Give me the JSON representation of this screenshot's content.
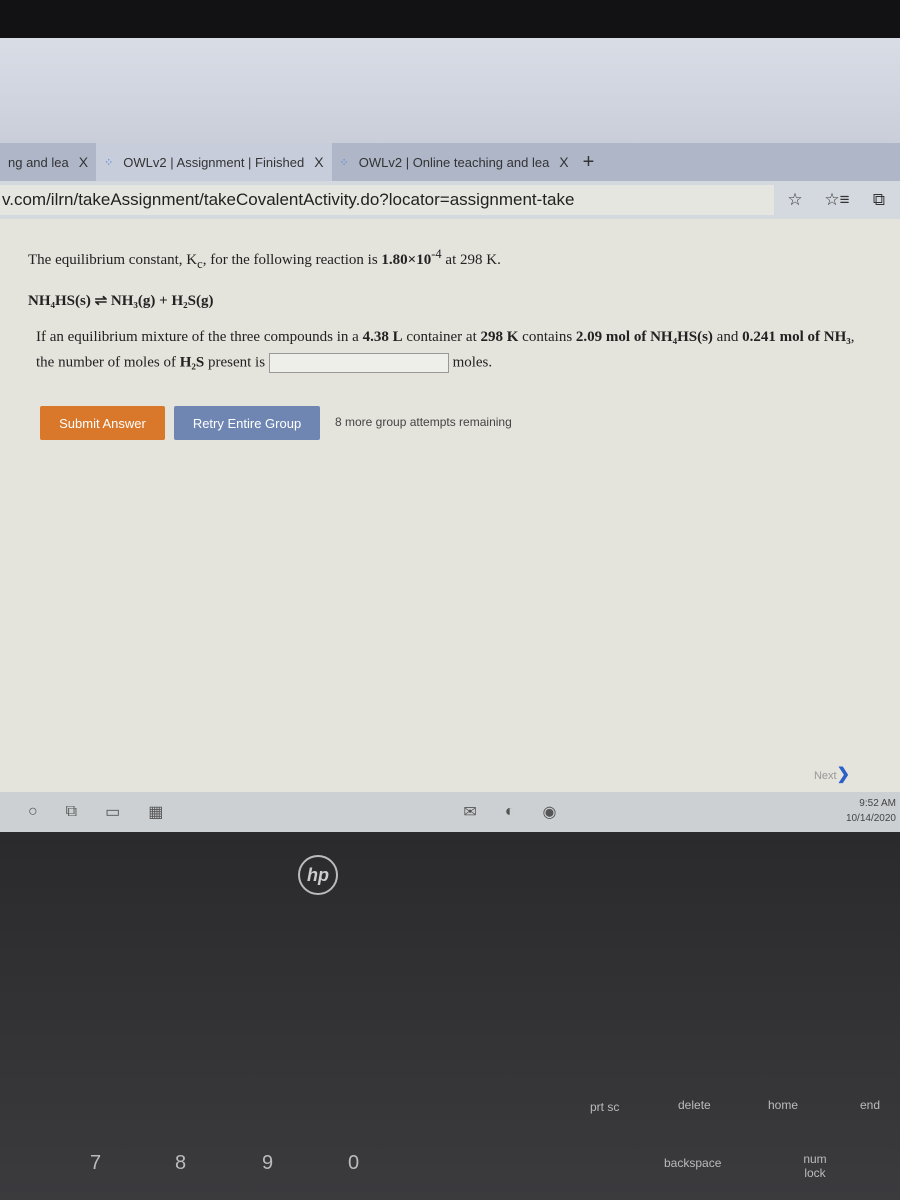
{
  "browser": {
    "tabs": [
      {
        "label": "ng and lea",
        "close": "X"
      },
      {
        "label": "OWLv2 | Assignment | Finished",
        "close": "X"
      },
      {
        "label": "OWLv2 | Online teaching and lea",
        "close": "X"
      }
    ],
    "new_tab": "+",
    "url": "v.com/ilrn/takeAssignment/takeCovalentActivity.do?locator=assignment-take",
    "icons": [
      "star-icon",
      "favorites-icon",
      "collections-icon"
    ]
  },
  "question": {
    "intro_a": "The equilibrium constant, K",
    "intro_sub": "c",
    "intro_b": ", for the following reaction is ",
    "k_value": "1.80×10",
    "k_exp": "-4",
    "intro_c": " at 298 K.",
    "reaction": "NH₄HS(s) ⇌ NH₃(g) + H₂S(g)",
    "line1_a": "If an equilibrium mixture of the three compounds in a ",
    "volume": "4.38 L",
    "line1_b": " container at ",
    "temp": "298 K",
    "line1_c": " contains ",
    "mol_nh4hs": "2.09 mol of NH₄HS(s)",
    "line1_d": " and ",
    "mol_nh3": "0.241 mol of NH₃",
    "line1_e": ",",
    "line2_a": "the number of moles of ",
    "line2_b": "H₂S",
    "line2_c": " present is",
    "answer_value": "",
    "unit": "moles."
  },
  "actions": {
    "submit": "Submit Answer",
    "retry": "Retry Entire Group",
    "remaining": "8 more group attempts remaining",
    "next": "Next"
  },
  "taskbar": {
    "time": "9:52 AM",
    "date": "10/14/2020"
  },
  "laptop": {
    "logo": "hp",
    "keys": [
      "prt sc",
      "delete",
      "home",
      "end",
      "backspace",
      "num lock",
      "7",
      "8",
      "9",
      "0"
    ]
  }
}
